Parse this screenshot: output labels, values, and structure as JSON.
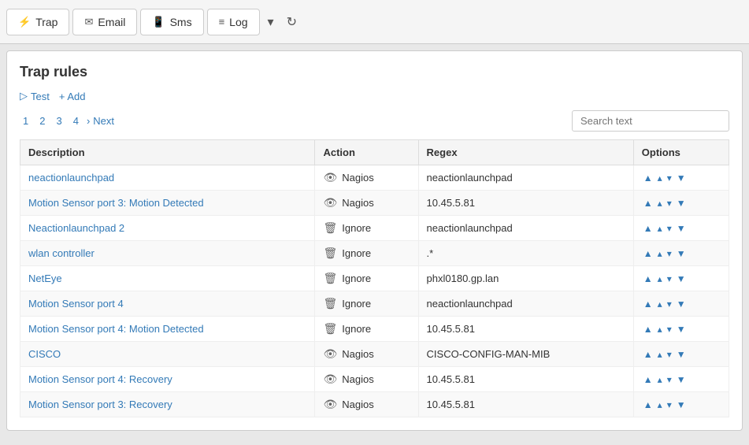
{
  "nav": {
    "tabs": [
      {
        "id": "trap",
        "label": "Trap",
        "icon": "⚡",
        "active": true
      },
      {
        "id": "email",
        "label": "Email",
        "icon": "✉"
      },
      {
        "id": "sms",
        "label": "Sms",
        "icon": "📱"
      },
      {
        "id": "log",
        "label": "Log",
        "icon": "≡"
      }
    ],
    "chevron_label": "▾",
    "refresh_label": "↻"
  },
  "page": {
    "title": "Trap rules",
    "test_label": "Test",
    "add_label": "+ Add"
  },
  "pagination": {
    "pages": [
      "1",
      "2",
      "3",
      "4"
    ],
    "next_label": "Next"
  },
  "search": {
    "placeholder": "Search text"
  },
  "table": {
    "headers": [
      "Description",
      "Action",
      "Regex",
      "Options"
    ],
    "rows": [
      {
        "description": "neactionlaunchpad",
        "action_icon": "👁",
        "action": "Nagios",
        "regex": "neactionlaunchpad"
      },
      {
        "description": "Motion Sensor port 3: Motion Detected",
        "action_icon": "👁",
        "action": "Nagios",
        "regex": "10.45.5.81"
      },
      {
        "description": "Neactionlaunchpad 2",
        "action_icon": "🗑",
        "action": "Ignore",
        "regex": "neactionlaunchpad"
      },
      {
        "description": "wlan controller",
        "action_icon": "🗑",
        "action": "Ignore",
        "regex": ".*"
      },
      {
        "description": "NetEye",
        "action_icon": "🗑",
        "action": "Ignore",
        "regex": "phxl0180.gp.lan"
      },
      {
        "description": "Motion Sensor port 4",
        "action_icon": "🗑",
        "action": "Ignore",
        "regex": "neactionlaunchpad"
      },
      {
        "description": "Motion Sensor port 4: Motion Detected",
        "action_icon": "🗑",
        "action": "Ignore",
        "regex": "10.45.5.81"
      },
      {
        "description": "CISCO",
        "action_icon": "👁",
        "action": "Nagios",
        "regex": "CISCO-CONFIG-MAN-MIB"
      },
      {
        "description": "Motion Sensor port 4: Recovery",
        "action_icon": "👁",
        "action": "Nagios",
        "regex": "10.45.5.81"
      },
      {
        "description": "Motion Sensor port 3: Recovery",
        "action_icon": "👁",
        "action": "Nagios",
        "regex": "10.45.5.81"
      }
    ]
  }
}
